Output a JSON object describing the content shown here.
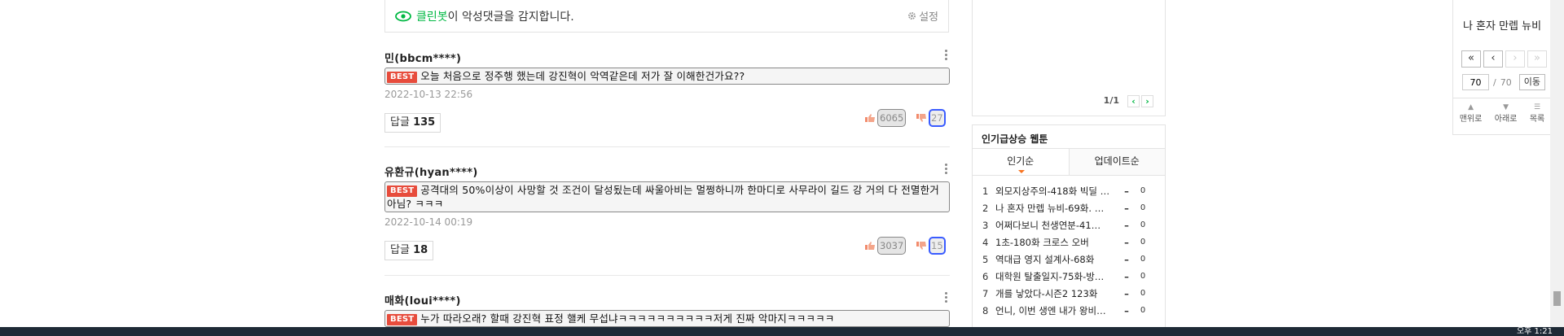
{
  "cleanbot": {
    "brand": "클린봇",
    "message": "이 악성댓글을 감지합니다.",
    "settings_label": "설정"
  },
  "comments": [
    {
      "nick": "민(bbcm****)",
      "best": "BEST",
      "text": "오늘 처음으로 정주행 했는데 강진혁이 악역같은데 저가 잘 이해한건가요??",
      "date": "2022-10-13 22:56",
      "reply_label": "답글",
      "reply_count": "135",
      "likes": "6065",
      "dislikes": "27"
    },
    {
      "nick": "유환규(hyan****)",
      "best": "BEST",
      "text": "공격대의 50%이상이 사망할 것 조건이 달성됬는데 싸울아비는 멀쩡하니까 한마디로 사무라이 길드 강 거의 다 전멸한거 아님? ㅋㅋㅋ",
      "date": "2022-10-14 00:19",
      "reply_label": "답글",
      "reply_count": "18",
      "likes": "3037",
      "dislikes": "15"
    },
    {
      "nick": "매화(loui****)",
      "best": "BEST",
      "text": "누가 따라오래? 할때 강진혁 표정 핼케 무섭냐ㅋㅋㅋㅋㅋㅋㅋㅋㅋㅋ저게 진짜 악마지ㅋㅋㅋㅋㅋ"
    }
  ],
  "middle": {
    "page_indicator": "1/1",
    "rank_title": "인기급상승 웹툰",
    "tabs": [
      "인기순",
      "업데이트순"
    ],
    "rank_items": [
      {
        "rank": "1",
        "title": "외모지상주의-418화 빅딜 …",
        "change": "–",
        "count": "0"
      },
      {
        "rank": "2",
        "title": "나 혼자 만렙 뉴비-69화. …",
        "change": "–",
        "count": "0"
      },
      {
        "rank": "3",
        "title": "어쩌다보니 천생연분-41…",
        "change": "–",
        "count": "0"
      },
      {
        "rank": "4",
        "title": "1초-180화 크로스 오버",
        "change": "–",
        "count": "0"
      },
      {
        "rank": "5",
        "title": "역대급 영지 설계사-68화",
        "change": "–",
        "count": "0"
      },
      {
        "rank": "6",
        "title": "대학원 탈출일지-75화-방…",
        "change": "–",
        "count": "0"
      },
      {
        "rank": "7",
        "title": "개를 낳았다-시즌2 123화",
        "change": "–",
        "count": "0"
      },
      {
        "rank": "8",
        "title": "언니, 이번 생엔 내가 왕비…",
        "change": "–",
        "count": "0"
      }
    ]
  },
  "side_nav": {
    "title": "나 혼자 만렙 뉴비",
    "first": "«",
    "prev": "‹",
    "next": "›",
    "last": "»",
    "current_page": "70",
    "separator": "/",
    "total_pages": "70",
    "go_label": "이동",
    "top_label": "맨위로",
    "down_label": "아래로",
    "list_label": "목록"
  },
  "taskbar": {
    "clock": "오후 1:21"
  },
  "colors": {
    "accent": "#00b843",
    "best_badge": "#e74c3c",
    "dislike_highlight": "#3a5cff",
    "taskbar": "#1e2a36"
  }
}
